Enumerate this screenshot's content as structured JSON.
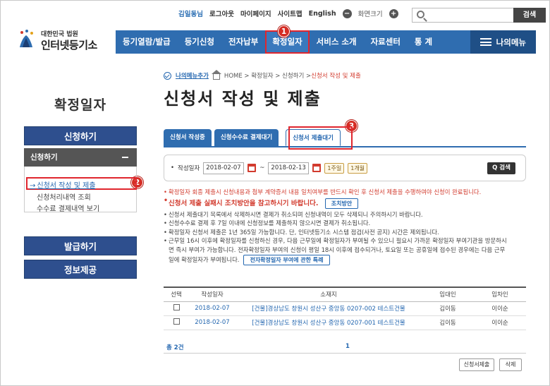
{
  "util": {
    "user": "김일동님",
    "logout": "로그아웃",
    "mypage": "마이페이지",
    "sitemap": "사이트맵",
    "english": "English",
    "zoom_minus": "−",
    "zoom_label": "화면크기",
    "zoom_plus": "+",
    "search_placeholder": "",
    "search_button": "검색"
  },
  "logo": {
    "small": "대한민국 법원",
    "big": "인터넷등기소"
  },
  "gnb": {
    "items": [
      "등기열람/발급",
      "등기신청",
      "전자납부",
      "확정일자",
      "서비스 소개",
      "자료센터",
      "통 계"
    ],
    "my_menu": "나의메뉴"
  },
  "badges": [
    "1",
    "2",
    "3"
  ],
  "sidebar": {
    "title": "확정일자",
    "btn_apply": "신청하기",
    "sub_header": "신청하기",
    "links": [
      "신청서 작성 및 제출",
      "신청처리내역 조회",
      "수수료 결제내역 보기"
    ],
    "btn_issue": "발급하기",
    "btn_info": "정보제공"
  },
  "breadcrumb": {
    "my_add": "나의메뉴추가",
    "path": "HOME > 확정일자 > 신청하기 > ",
    "current": "신청서 작성 및 제출"
  },
  "page_title": "신청서 작성 및 제출",
  "tabs": [
    "신청서 작성중",
    "신청수수료 결제대기",
    "신청서 제출대기"
  ],
  "filter": {
    "label": "작성일자",
    "date_from": "2018-02-07",
    "sep": "~",
    "date_to": "2018-02-13",
    "one_week": "1주일",
    "one_month": "1개월",
    "search": "Q 검색"
  },
  "notes": {
    "n1": "확정일자 회종 제출시 신청내용과 첨부 계약증서 내용 일치여부를 반드시 확인 후 신청서 제출을 수행하여야 신청이 완료됩니다.",
    "n2": "신청서 제출 실패시 조치방안을 참고하시기 바랍니다.",
    "n2_btn": "조치방안",
    "n3": "신청서 제출대기 목록에서 삭제하시면 결제가 취소되며 신청내역이 모두 삭제되니 주의하시기 바랍니다.",
    "n4": "신청수수료 결제 후 7일 이내에 신청정보를 제출하지 않으시면 결제가 취소됩니다.",
    "n5": "확정일자 신청서 제출은 1년 365일 가능합니다. 단, 인터넷등기소 시스템 점검(사전 공지) 시간은 제외됩니다.",
    "n6a": "근무일 16시 이후에 확정일자를 신청하신 경우, 다음 근무일에 확정일자가 부여될 수 있으니 필요시 가까운 확정일자 부여기관을 방문하시",
    "n6b": "면 즉시 부여가 가능합니다. 전자확정일자 부여의 신청이 평일 18시 이후에 접수되거나, 토요일 또는 공휴일에 접수된 경우에는 다음 근무",
    "n6c": "일에 확정일자가 부여됩니다.",
    "n6_btn": "전자확정일자 부여에 관한 특례"
  },
  "table": {
    "headers": [
      "선택",
      "작성일자",
      "소재지",
      "임대인",
      "임차인"
    ],
    "rows": [
      {
        "date": "2018-02-07",
        "addr": "[건물]경상남도 창원시 성산구 중앙동 0207-002 테스트건물",
        "lessor": "김이동",
        "lessee": "이이순"
      },
      {
        "date": "2018-02-07",
        "addr": "[건물]경상남도 창원시 성산구 중앙동 0207-001 테스트건물",
        "lessor": "김이동",
        "lessee": "이이순"
      }
    ]
  },
  "total": "총 2건",
  "page": "1",
  "buttons": {
    "submit": "신청서제출",
    "delete": "삭제"
  },
  "colors": {
    "primary_blue": "#2f6db0",
    "nav_dark": "#2e4f8e",
    "highlight_red": "#e0262e",
    "warning_red": "#d23b2e"
  }
}
